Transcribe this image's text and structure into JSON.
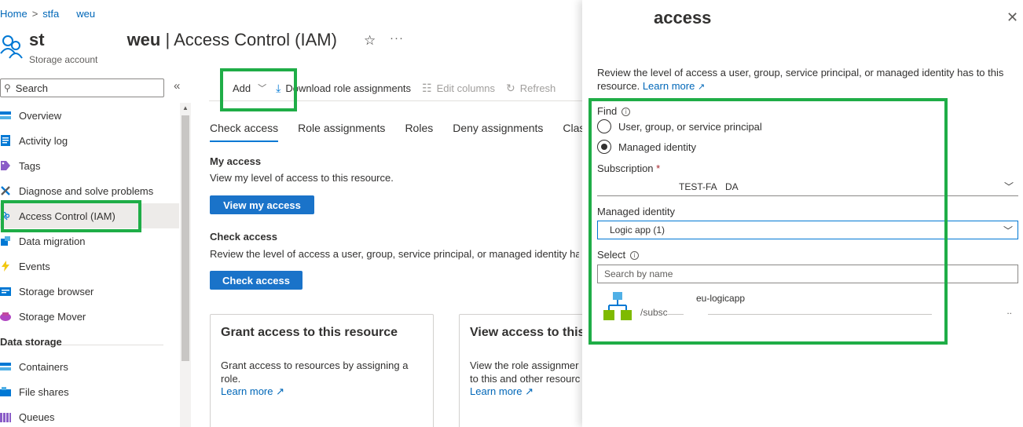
{
  "breadcrumb": {
    "home": "Home",
    "separator": ">",
    "resource": "stfa",
    "resource_suffix": "weu"
  },
  "header": {
    "name_prefix": "st",
    "name_suffix": "weu",
    "separator": " | ",
    "page": "Access Control (IAM)",
    "resource_type": "Storage account"
  },
  "search": {
    "placeholder": "Search"
  },
  "sidebar": {
    "items": [
      {
        "label": "Overview",
        "icon": "overview-icon"
      },
      {
        "label": "Activity log",
        "icon": "activity-log-icon"
      },
      {
        "label": "Tags",
        "icon": "tag-icon"
      },
      {
        "label": "Diagnose and solve problems",
        "icon": "wrench-icon"
      },
      {
        "label": "Access Control (IAM)",
        "icon": "people-icon"
      },
      {
        "label": "Data migration",
        "icon": "data-migration-icon"
      },
      {
        "label": "Events",
        "icon": "lightning-icon"
      },
      {
        "label": "Storage browser",
        "icon": "storage-browser-icon"
      },
      {
        "label": "Storage Mover",
        "icon": "storage-mover-icon"
      }
    ],
    "section": "Data storage",
    "storage_items": [
      {
        "label": "Containers",
        "icon": "containers-icon"
      },
      {
        "label": "File shares",
        "icon": "file-shares-icon"
      },
      {
        "label": "Queues",
        "icon": "queues-icon"
      }
    ]
  },
  "toolbar": {
    "add": "Add",
    "download": "Download role assignments",
    "edit_columns": "Edit columns",
    "refresh": "Refresh"
  },
  "tabs": [
    "Check access",
    "Role assignments",
    "Roles",
    "Deny assignments",
    "Class"
  ],
  "my_access": {
    "title": "My access",
    "text": "View my level of access to this resource.",
    "button": "View my access"
  },
  "check_access": {
    "title": "Check access",
    "text": "Review the level of access a user, group, service principal, or managed identity has",
    "button": "Check access"
  },
  "cards": [
    {
      "title": "Grant access to this resource",
      "text": "Grant access to resources by assigning a role.",
      "link": "Learn more"
    },
    {
      "title": "View access to this",
      "text": "View the role assignmer to this and other resourc",
      "link": "Learn more"
    }
  ],
  "panel": {
    "title": "access",
    "description": "Review the level of access a user, group, service principal, or managed identity has to this resource.",
    "learn_more": "Learn more",
    "find_label": "Find",
    "find_options": [
      "User, group, or service principal",
      "Managed identity"
    ],
    "subscription_label": "Subscription",
    "required_mark": "*",
    "subscription_value_left": "TEST-FA",
    "subscription_value_right": "DA",
    "managed_identity_label": "Managed identity",
    "managed_identity_value": "Logic app (1)",
    "select_label": "Select",
    "select_placeholder": "Search by name",
    "result_name": "eu-logicapp",
    "result_path": "/subsc",
    "result_more": ".."
  },
  "colors": {
    "highlight": "#1fad47",
    "accent": "#0078d4",
    "primary_button": "#1a73c9",
    "link": "#0067b8"
  }
}
